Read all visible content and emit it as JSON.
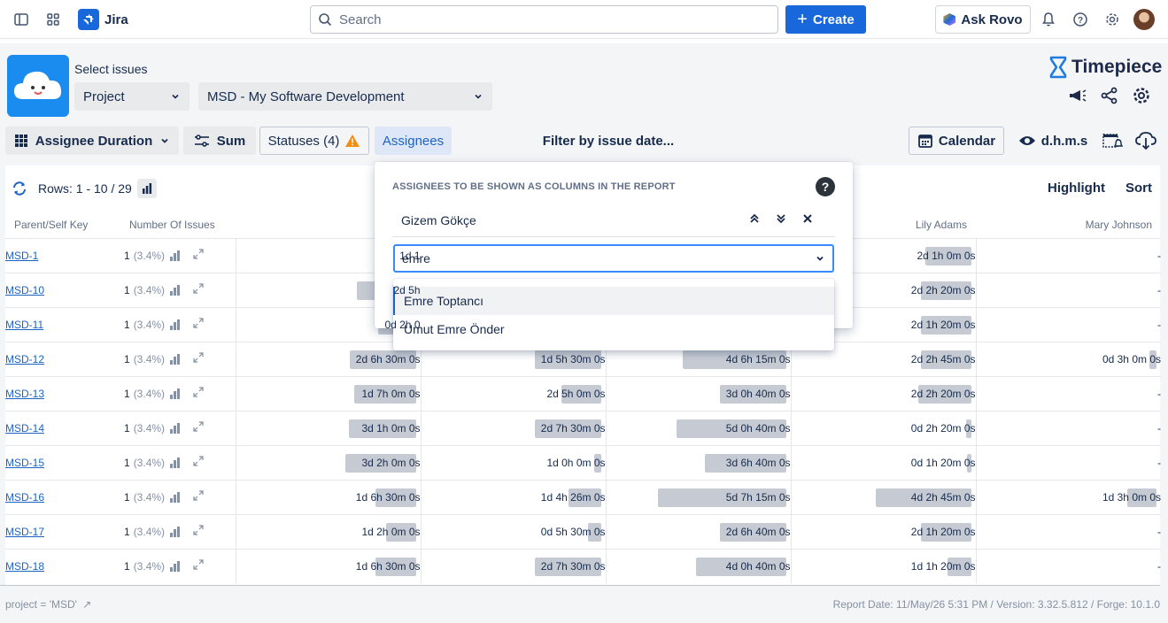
{
  "topbar": {
    "app_name": "Jira",
    "search_placeholder": "Search",
    "create_label": "Create",
    "ask_rovo_label": "Ask Rovo"
  },
  "selector": {
    "label": "Select issues",
    "type_value": "Project",
    "project_value": "MSD - My Software Development"
  },
  "brand": {
    "name": "Timepiece"
  },
  "toolbar": {
    "report_type": "Assignee Duration",
    "sum_label": "Sum",
    "statuses_label": "Statuses (4)",
    "assignees_label": "Assignees",
    "filter_label": "Filter by issue date...",
    "calendar_label": "Calendar",
    "format_label": "d.h.m.s"
  },
  "table": {
    "rows_info": "Rows: 1 - 10 / 29",
    "highlight_label": "Highlight",
    "sort_label": "Sort",
    "columns": [
      "Parent/Self Key",
      "Number Of Issues",
      "",
      "",
      "",
      "Lily Adams",
      "Mary Johnson"
    ],
    "rows": [
      {
        "key": "MSD-1",
        "count": "1",
        "pct": "(3.4%)",
        "c1": "1d 1",
        "c2": "",
        "c3": "",
        "c4": "2d 1h 0m 0s",
        "c5": "-"
      },
      {
        "key": "MSD-10",
        "count": "1",
        "pct": "(3.4%)",
        "c1": "2d 5h",
        "c2": "",
        "c3": "",
        "c4": "2d 2h 20m 0s",
        "c5": "-"
      },
      {
        "key": "MSD-11",
        "count": "1",
        "pct": "(3.4%)",
        "c1": "0d 2h 0",
        "c2": "",
        "c3": "",
        "c4": "2d 1h 20m 0s",
        "c5": "-"
      },
      {
        "key": "MSD-12",
        "count": "1",
        "pct": "(3.4%)",
        "c1": "2d 6h 30m 0s",
        "c2": "1d 5h 30m 0s",
        "c3": "4d 6h 15m 0s",
        "c4": "2d 2h 45m 0s",
        "c5": "0d 3h 0m 0s"
      },
      {
        "key": "MSD-13",
        "count": "1",
        "pct": "(3.4%)",
        "c1": "1d 7h 0m 0s",
        "c2": "2d 5h 0m 0s",
        "c3": "3d 0h 40m 0s",
        "c4": "2d 2h 20m 0s",
        "c5": "-"
      },
      {
        "key": "MSD-14",
        "count": "1",
        "pct": "(3.4%)",
        "c1": "3d 1h 0m 0s",
        "c2": "2d 7h 30m 0s",
        "c3": "5d 0h 40m 0s",
        "c4": "0d 2h 20m 0s",
        "c5": "-"
      },
      {
        "key": "MSD-15",
        "count": "1",
        "pct": "(3.4%)",
        "c1": "3d 2h 0m 0s",
        "c2": "1d 0h 0m 0s",
        "c3": "3d 6h 40m 0s",
        "c4": "0d 1h 20m 0s",
        "c5": "-"
      },
      {
        "key": "MSD-16",
        "count": "1",
        "pct": "(3.4%)",
        "c1": "1d 6h 30m 0s",
        "c2": "1d 4h 26m 0s",
        "c3": "5d 7h 15m 0s",
        "c4": "4d 2h 45m 0s",
        "c5": "1d 3h 0m 0s"
      },
      {
        "key": "MSD-17",
        "count": "1",
        "pct": "(3.4%)",
        "c1": "1d 2h 0m 0s",
        "c2": "0d 5h 30m 0s",
        "c3": "2d 6h 40m 0s",
        "c4": "2d 1h 20m 0s",
        "c5": "-"
      },
      {
        "key": "MSD-18",
        "count": "1",
        "pct": "(3.4%)",
        "c1": "1d 6h 30m 0s",
        "c2": "2d 7h 30m 0s",
        "c3": "4d 0h 40m 0s",
        "c4": "1d 1h 20m 0s",
        "c5": "-"
      }
    ]
  },
  "dialog": {
    "title": "ASSIGNEES TO BE SHOWN AS COLUMNS IN THE REPORT",
    "selected_assignee": "Gizem Gökçe",
    "input_value": "emre",
    "options": [
      "Emre Toptancı",
      "Umut Emre Önder"
    ]
  },
  "footer": {
    "query": "project = 'MSD'",
    "report_info": "Report Date: 11/May/26 5:31 PM / Version: 3.32.5.812 / Forge: 10.1.0"
  }
}
